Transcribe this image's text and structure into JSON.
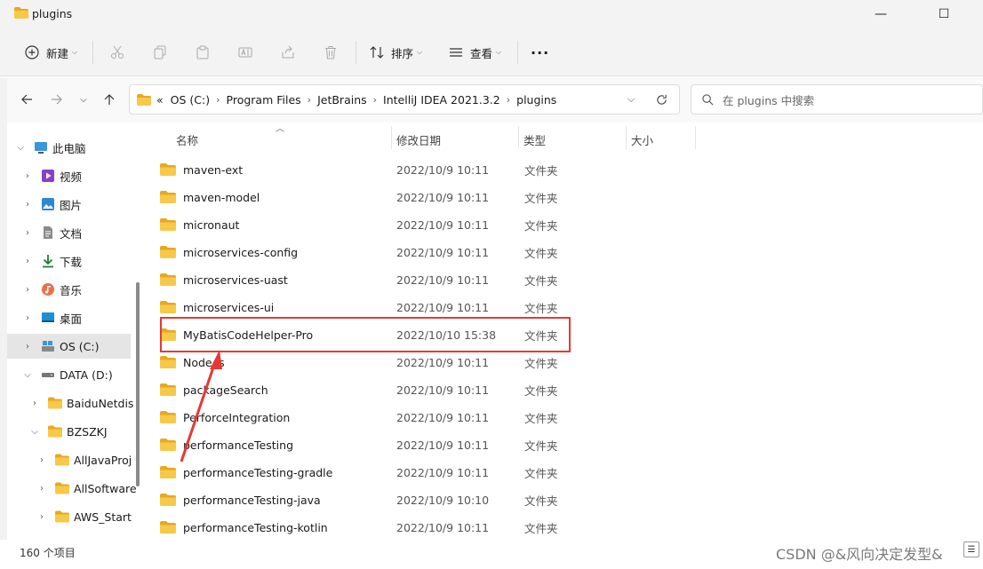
{
  "window": {
    "title": "plugins",
    "minimize": "—",
    "maximize": "☐",
    "close": "✕"
  },
  "toolbar": {
    "new_label": "新建",
    "sort_label": "排序",
    "view_label": "查看",
    "more_label": "···"
  },
  "address": {
    "overflow": "«",
    "crumbs": [
      "OS (C:)",
      "Program Files",
      "JetBrains",
      "IntelliJ IDEA 2021.3.2",
      "plugins"
    ]
  },
  "search": {
    "placeholder": "在 plugins 中搜索"
  },
  "sidebar": {
    "items": [
      {
        "label": "此电脑",
        "icon": "computer-icon"
      },
      {
        "label": "视频",
        "icon": "video-icon"
      },
      {
        "label": "图片",
        "icon": "picture-icon"
      },
      {
        "label": "文档",
        "icon": "document-icon"
      },
      {
        "label": "下载",
        "icon": "download-icon"
      },
      {
        "label": "音乐",
        "icon": "music-icon"
      },
      {
        "label": "桌面",
        "icon": "desktop-icon"
      },
      {
        "label": "OS (C:)",
        "icon": "drive-icon"
      },
      {
        "label": "DATA (D:)",
        "icon": "drive-icon"
      },
      {
        "label": "BaiduNetdis",
        "icon": "folder-icon"
      },
      {
        "label": "BZSZKJ",
        "icon": "folder-icon"
      },
      {
        "label": "AllJavaProj",
        "icon": "folder-icon"
      },
      {
        "label": "AllSoftware",
        "icon": "folder-icon"
      },
      {
        "label": "AWS_Start",
        "icon": "folder-icon"
      }
    ]
  },
  "columns": {
    "name": "名称",
    "date": "修改日期",
    "type": "类型",
    "size": "大小"
  },
  "files": [
    {
      "name": "maven-ext",
      "date": "2022/10/9 10:11",
      "type": "文件夹"
    },
    {
      "name": "maven-model",
      "date": "2022/10/9 10:11",
      "type": "文件夹"
    },
    {
      "name": "micronaut",
      "date": "2022/10/9 10:11",
      "type": "文件夹"
    },
    {
      "name": "microservices-config",
      "date": "2022/10/9 10:11",
      "type": "文件夹"
    },
    {
      "name": "microservices-uast",
      "date": "2022/10/9 10:11",
      "type": "文件夹"
    },
    {
      "name": "microservices-ui",
      "date": "2022/10/9 10:11",
      "type": "文件夹"
    },
    {
      "name": "MyBatisCodeHelper-Pro",
      "date": "2022/10/10 15:38",
      "type": "文件夹"
    },
    {
      "name": "Node.js",
      "date": "2022/10/9 10:11",
      "type": "文件夹"
    },
    {
      "name": "packageSearch",
      "date": "2022/10/9 10:11",
      "type": "文件夹"
    },
    {
      "name": "PerforceIntegration",
      "date": "2022/10/9 10:11",
      "type": "文件夹"
    },
    {
      "name": "performanceTesting",
      "date": "2022/10/9 10:11",
      "type": "文件夹"
    },
    {
      "name": "performanceTesting-gradle",
      "date": "2022/10/9 10:11",
      "type": "文件夹"
    },
    {
      "name": "performanceTesting-java",
      "date": "2022/10/9 10:10",
      "type": "文件夹"
    },
    {
      "name": "performanceTesting-kotlin",
      "date": "2022/10/9 10:11",
      "type": "文件夹"
    }
  ],
  "status": {
    "count": "160 个项目",
    "watermark": "CSDN @&风向决定发型&"
  },
  "colors": {
    "folder": "#f7c948",
    "folder_dark": "#e9a820",
    "highlight": "#e53935",
    "accent": "#0067c0"
  }
}
